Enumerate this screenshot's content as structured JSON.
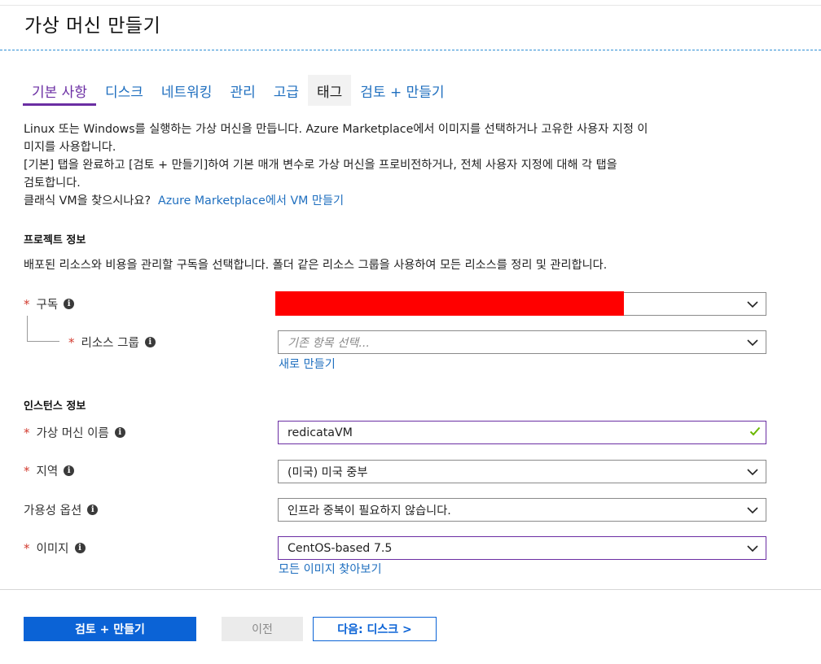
{
  "header": {
    "title": "가상 머신 만들기"
  },
  "tabs": [
    {
      "label": "기본 사항"
    },
    {
      "label": "디스크"
    },
    {
      "label": "네트워킹"
    },
    {
      "label": "관리"
    },
    {
      "label": "고급"
    },
    {
      "label": "태그"
    },
    {
      "label": "검토 + 만들기"
    }
  ],
  "intro": {
    "line1": "Linux 또는 Windows를 실행하는 가상 머신을 만듭니다. Azure Marketplace에서 이미지를 선택하거나 고유한 사용자 지정 이",
    "line2": "미지를 사용합니다.",
    "line3": "[기본] 탭을 완료하고 [검토 + 만들기]하여 기본 매개 변수로 가상 머신을 프로비전하거나, 전체 사용자 지정에 대해 각 탭을",
    "line4": "검토합니다.",
    "classic_prefix": "클래식 VM을 찾으시나요?",
    "classic_link": "Azure Marketplace에서 VM 만들기"
  },
  "project": {
    "title": "프로젝트 정보",
    "desc": "배포된 리소스와 비용을 관리할 구독을 선택합니다. 폴더 같은 리소스 그룹을 사용하여 모든 리소스를 정리 및 관리합니다.",
    "subscription_label": "구독",
    "subscription_value": "",
    "resource_group_label": "리소스 그룹",
    "resource_group_placeholder": "기존 항목 선택...",
    "create_new": "새로 만들기"
  },
  "instance": {
    "title": "인스턴스 정보",
    "vm_name_label": "가상 머신 이름",
    "vm_name_value": "redicataVM",
    "region_label": "지역",
    "region_value": "(미국) 미국 중부",
    "availability_label": "가용성 옵션",
    "availability_value": "인프라 중복이 필요하지 않습니다.",
    "image_label": "이미지",
    "image_value": "CentOS-based 7.5",
    "browse_images": "모든 이미지 찾아보기"
  },
  "footer": {
    "review_button": "검토 + 만들기",
    "prev_button": "이전",
    "next_button": "다음: 디스크 >"
  },
  "icons": {
    "info": "i",
    "required": "*"
  },
  "colors": {
    "accent": "#6b2ea3",
    "link": "#1f6fbf",
    "primary_button": "#0b63d6",
    "required": "#d23b2f",
    "valid_check": "#6bb700",
    "redaction": "#ff0000"
  }
}
